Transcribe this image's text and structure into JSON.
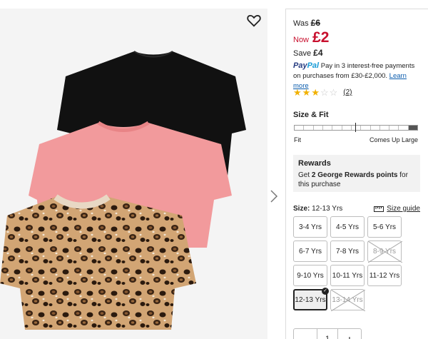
{
  "price": {
    "was_label": "Was",
    "was_value": "£6",
    "now_label": "Now",
    "now_value": "£2",
    "save_label": "Save",
    "save_value": "£4"
  },
  "paypal": {
    "logo_part1": "Pay",
    "logo_part2": "Pal",
    "message": "Pay in 3 interest-free payments on purchases from £30-£2,000.",
    "link": "Learn more"
  },
  "rating": {
    "score": 3,
    "max": 5,
    "count": "(2)"
  },
  "fit": {
    "title": "Size & Fit",
    "left_label": "Fit",
    "right_label": "Comes Up Large"
  },
  "rewards": {
    "title": "Rewards",
    "text_pre": "Get ",
    "points": "2 George Rewards points",
    "text_post": " for this purchase"
  },
  "size": {
    "label": "Size:",
    "selected": "12-13 Yrs",
    "guide": "Size guide",
    "options": [
      {
        "label": "3-4 Yrs",
        "available": true
      },
      {
        "label": "4-5 Yrs",
        "available": true
      },
      {
        "label": "5-6 Yrs",
        "available": true
      },
      {
        "label": "6-7 Yrs",
        "available": true
      },
      {
        "label": "7-8 Yrs",
        "available": true
      },
      {
        "label": "8-9 Yrs",
        "available": false
      },
      {
        "label": "9-10 Yrs",
        "available": true
      },
      {
        "label": "10-11 Yrs",
        "available": true
      },
      {
        "label": "11-12 Yrs",
        "available": true
      },
      {
        "label": "12-13 Yrs",
        "available": true
      },
      {
        "label": "13-14 Yrs",
        "available": false
      }
    ]
  },
  "quantity": {
    "minus": "-",
    "value": "1",
    "plus": "+"
  },
  "colors": {
    "sale_red": "#c8102e",
    "star_gold": "#f1b100",
    "link_blue": "#0b5cad"
  }
}
